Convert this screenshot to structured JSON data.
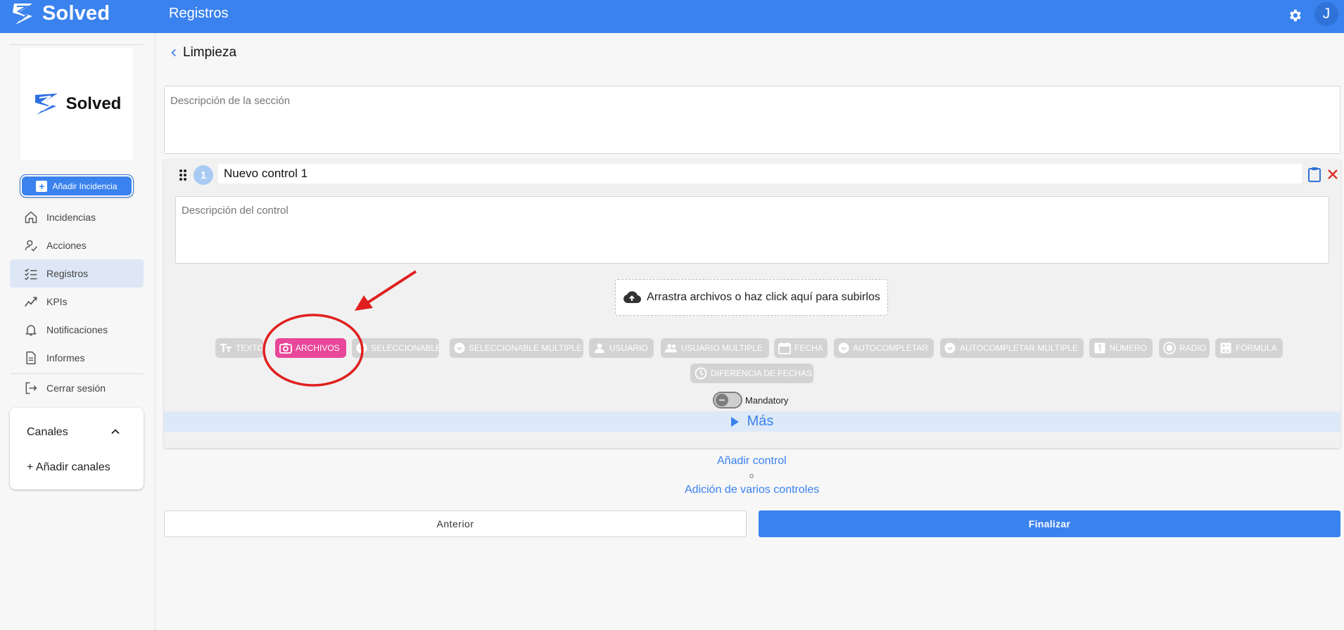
{
  "app": {
    "brand": "Solved",
    "page_title": "Registros",
    "user_initial": "J"
  },
  "sidebar": {
    "logo_text": "Solved",
    "add_incident_label": "Añadir Incidencia",
    "items": [
      {
        "label": "Incidencias",
        "icon": "home-icon"
      },
      {
        "label": "Acciones",
        "icon": "user-check-icon"
      },
      {
        "label": "Registros",
        "icon": "checklist-icon",
        "active": true
      },
      {
        "label": "KPIs",
        "icon": "trend-icon"
      },
      {
        "label": "Notificaciones",
        "icon": "bell-icon"
      },
      {
        "label": "Informes",
        "icon": "document-icon"
      },
      {
        "label": "Cerrar sesión",
        "icon": "logout-icon"
      }
    ],
    "channels": {
      "title": "Canales",
      "add_label": "+ Añadir canales"
    }
  },
  "main": {
    "section_name": "Limpieza",
    "section_desc_placeholder": "Descripción de la sección",
    "control": {
      "number": "1",
      "name": "Nuevo control 1",
      "desc_placeholder": "Descripción del control",
      "dropzone_label": "Arrastra archivos o haz click aquí para subirlos",
      "types": [
        {
          "label": "TEXTO",
          "icon": "text-icon"
        },
        {
          "label": "ARCHIVOS",
          "icon": "camera-icon",
          "selected": true
        },
        {
          "label": "SELECCIONABLE",
          "icon": "select-icon"
        },
        {
          "label": "SELECCIONABLE MULTIPLE",
          "icon": "select-multiple-icon"
        },
        {
          "label": "USUARIO",
          "icon": "user-icon"
        },
        {
          "label": "USUARIO MULTIPLE",
          "icon": "users-icon"
        },
        {
          "label": "FECHA",
          "icon": "calendar-icon"
        },
        {
          "label": "AUTOCOMPLETAR",
          "icon": "autocomplete-icon"
        },
        {
          "label": "AUTOCOMPLETAR MULTIPLE",
          "icon": "autocomplete-multiple-icon"
        },
        {
          "label": "NÚMERO",
          "icon": "number-icon"
        },
        {
          "label": "RADIO",
          "icon": "radio-icon"
        },
        {
          "label": "FÓRMULA",
          "icon": "formula-icon"
        },
        {
          "label": "DIFERENCIA DE FECHAS",
          "icon": "date-diff-icon"
        }
      ],
      "mandatory_label": "Mandatory",
      "mandatory_on": false,
      "more_label": "Más"
    },
    "add_control_label": "Añadir control",
    "or_label": "o",
    "add_multiple_label": "Adición de varios controles",
    "prev_label": "Anterior",
    "finish_label": "Finalizar"
  },
  "colors": {
    "primary": "#3a82ee",
    "selected_chip": "#e8479a",
    "annotation": "#e02020"
  }
}
